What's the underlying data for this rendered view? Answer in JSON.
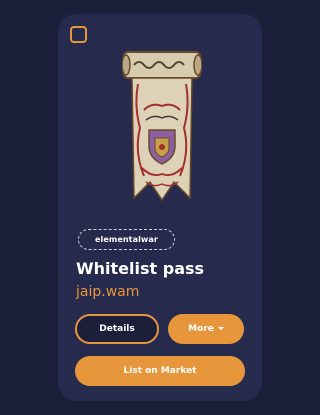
{
  "nft": {
    "collection": "elementalwar",
    "name": "Whitelist pass",
    "owner": "jaip.wam",
    "image_icon": "banner-image-icon"
  },
  "actions": {
    "details_label": "Details",
    "more_label": "More",
    "list_label": "List on Market"
  },
  "colors": {
    "background": "#1b1f3a",
    "card": "#262a4c",
    "accent": "#e8963c"
  }
}
